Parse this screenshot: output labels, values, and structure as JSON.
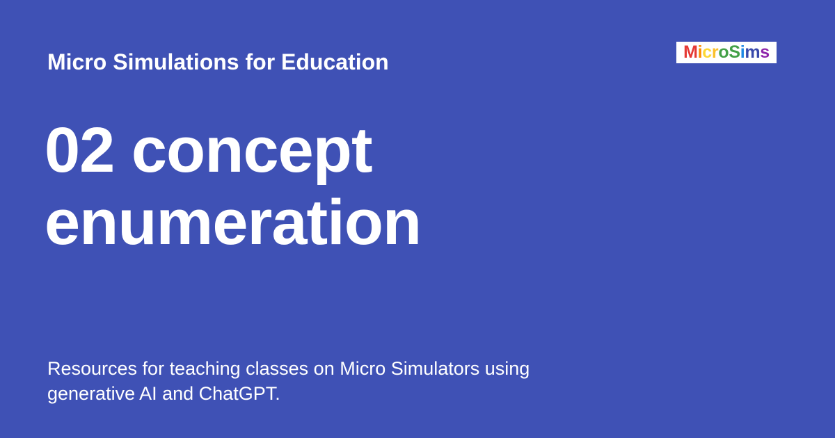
{
  "site": {
    "name": "Micro Simulations for Education"
  },
  "page": {
    "title": "02 concept enumeration",
    "description": "Resources for teaching classes on Micro Simulators using generative AI and ChatGPT."
  },
  "logo": {
    "text": "MicroSims",
    "letter_colors": [
      "#e53935",
      "#fb8c00",
      "#fdd835",
      "#fbc02d",
      "#43a047",
      "#43a047",
      "#1e88e5",
      "#3949ab",
      "#8e24aa"
    ]
  },
  "colors": {
    "background": "#3f51b5",
    "text": "#ffffff",
    "logo_background": "#ffffff"
  }
}
